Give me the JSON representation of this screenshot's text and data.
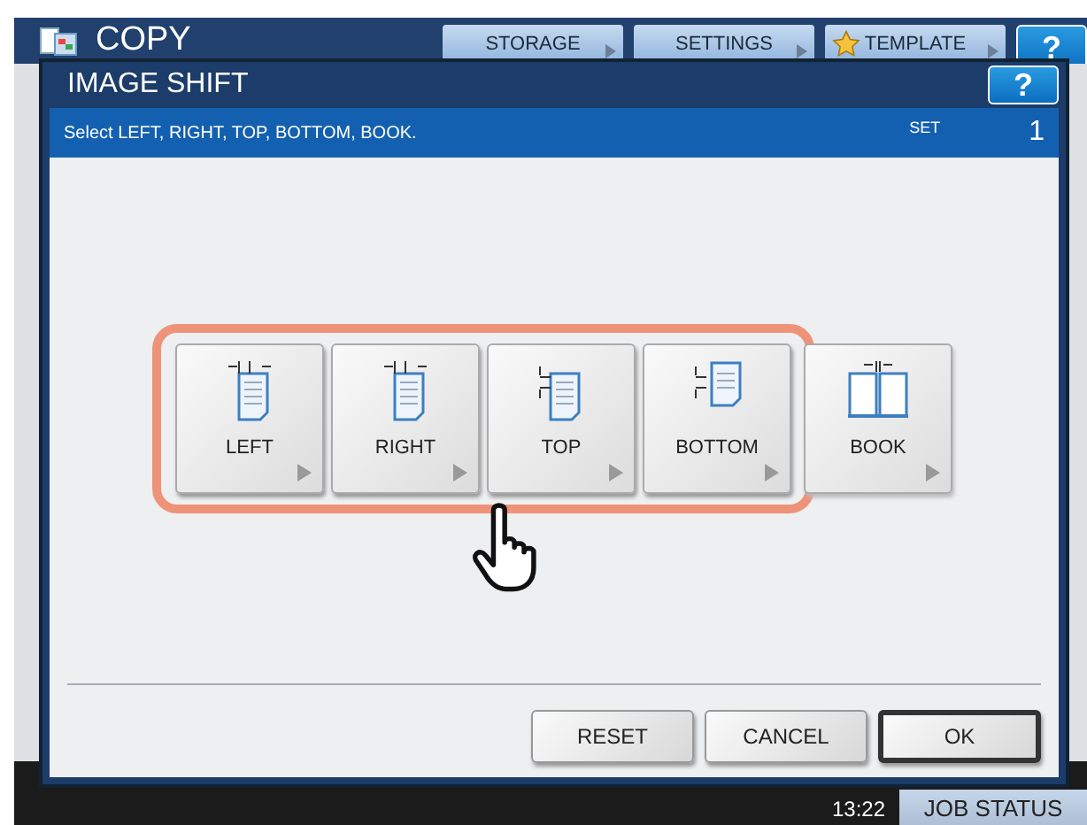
{
  "screen": {
    "title": "COPY",
    "tabs": [
      {
        "label": "STORAGE",
        "kind": "plain"
      },
      {
        "label": "SETTINGS",
        "kind": "plain"
      },
      {
        "label": "TEMPLATE",
        "kind": "star"
      }
    ],
    "help": "?"
  },
  "dialog": {
    "title": "IMAGE SHIFT",
    "help": "?",
    "message": "Select LEFT, RIGHT, TOP, BOTTOM, BOOK.",
    "set_label": "SET",
    "set_value": "1",
    "options": [
      {
        "label": "LEFT",
        "highlighted": true
      },
      {
        "label": "RIGHT",
        "highlighted": true
      },
      {
        "label": "TOP",
        "highlighted": true
      },
      {
        "label": "BOTTOM",
        "highlighted": true
      },
      {
        "label": "BOOK",
        "highlighted": false
      }
    ],
    "buttons": [
      {
        "label": "RESET",
        "default": false
      },
      {
        "label": "CANCEL",
        "default": false
      },
      {
        "label": "OK",
        "default": true
      }
    ]
  },
  "status_bar": {
    "time": "13:22",
    "job_status": "JOB STATUS"
  }
}
